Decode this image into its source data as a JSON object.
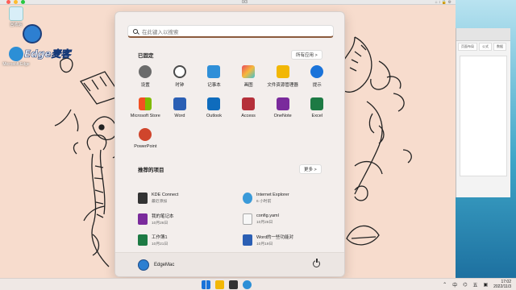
{
  "host": {
    "title": "0/3",
    "tools": "⌂  ↕  🔒  ⚙"
  },
  "desktop": {
    "icons": [
      {
        "label": "回收站"
      },
      {
        "label": "Microsoft Edge"
      }
    ],
    "logo_text": "Edge麦客"
  },
  "side_window": {
    "tabs": [
      "页面布局",
      "公式",
      "数据"
    ]
  },
  "start_menu": {
    "search_placeholder": "在此键入以搜索",
    "pinned_title": "已固定",
    "all_apps_label": "所有应用  >",
    "pinned": [
      {
        "label": "设置",
        "icon": "settings-icon",
        "color": "#6b6b6b"
      },
      {
        "label": "时钟",
        "icon": "clock-icon",
        "color": "#4a4a4a"
      },
      {
        "label": "记事本",
        "icon": "notepad-icon",
        "color": "#2f8fd8"
      },
      {
        "label": "画图",
        "icon": "paint-icon",
        "color": "#e8a33a"
      },
      {
        "label": "文件资源管理器",
        "icon": "folder-icon",
        "color": "#f2b705"
      },
      {
        "label": "提示",
        "icon": "tips-icon",
        "color": "#1a73d9"
      },
      {
        "label": "Microsoft Store",
        "icon": "store-icon",
        "color": "#1f6fd1"
      },
      {
        "label": "Word",
        "icon": "word-icon",
        "color": "#2b5fb4"
      },
      {
        "label": "Outlook",
        "icon": "outlook-icon",
        "color": "#0f6cbd"
      },
      {
        "label": "Access",
        "icon": "access-icon",
        "color": "#b5303a"
      },
      {
        "label": "OneNote",
        "icon": "onenote-icon",
        "color": "#7a2a9c"
      },
      {
        "label": "Excel",
        "icon": "excel-icon",
        "color": "#1d7a44"
      },
      {
        "label": "PowerPoint",
        "icon": "powerpoint-icon",
        "color": "#d0452c"
      }
    ],
    "recommended_title": "推荐的项目",
    "more_label": "更多  >",
    "recommended": [
      {
        "name": "KDE Connect",
        "sub": "最近添加",
        "icon": "kde-connect-icon",
        "color": "#333333"
      },
      {
        "name": "Internet Explorer",
        "sub": "6 小时前",
        "icon": "internet-explorer-icon",
        "color": "#3a9ad9"
      },
      {
        "name": "我的笔记本",
        "sub": "10月26日",
        "icon": "onenote-icon",
        "color": "#7a2a9c"
      },
      {
        "name": "config.yaml",
        "sub": "10月26日",
        "icon": "file-icon",
        "color": "#f2f2f2"
      },
      {
        "name": "工作簿1",
        "sub": "10月21日",
        "icon": "excel-icon",
        "color": "#1d7a44"
      },
      {
        "name": "Word的一些功能对",
        "sub": "10月19日",
        "icon": "word-icon",
        "color": "#2b5fb4"
      }
    ],
    "user_name": "EdgeMac"
  },
  "taskbar": {
    "tray_lang": "中",
    "tray_ime": "五",
    "time": "17:02",
    "date": "2022/11/3"
  }
}
